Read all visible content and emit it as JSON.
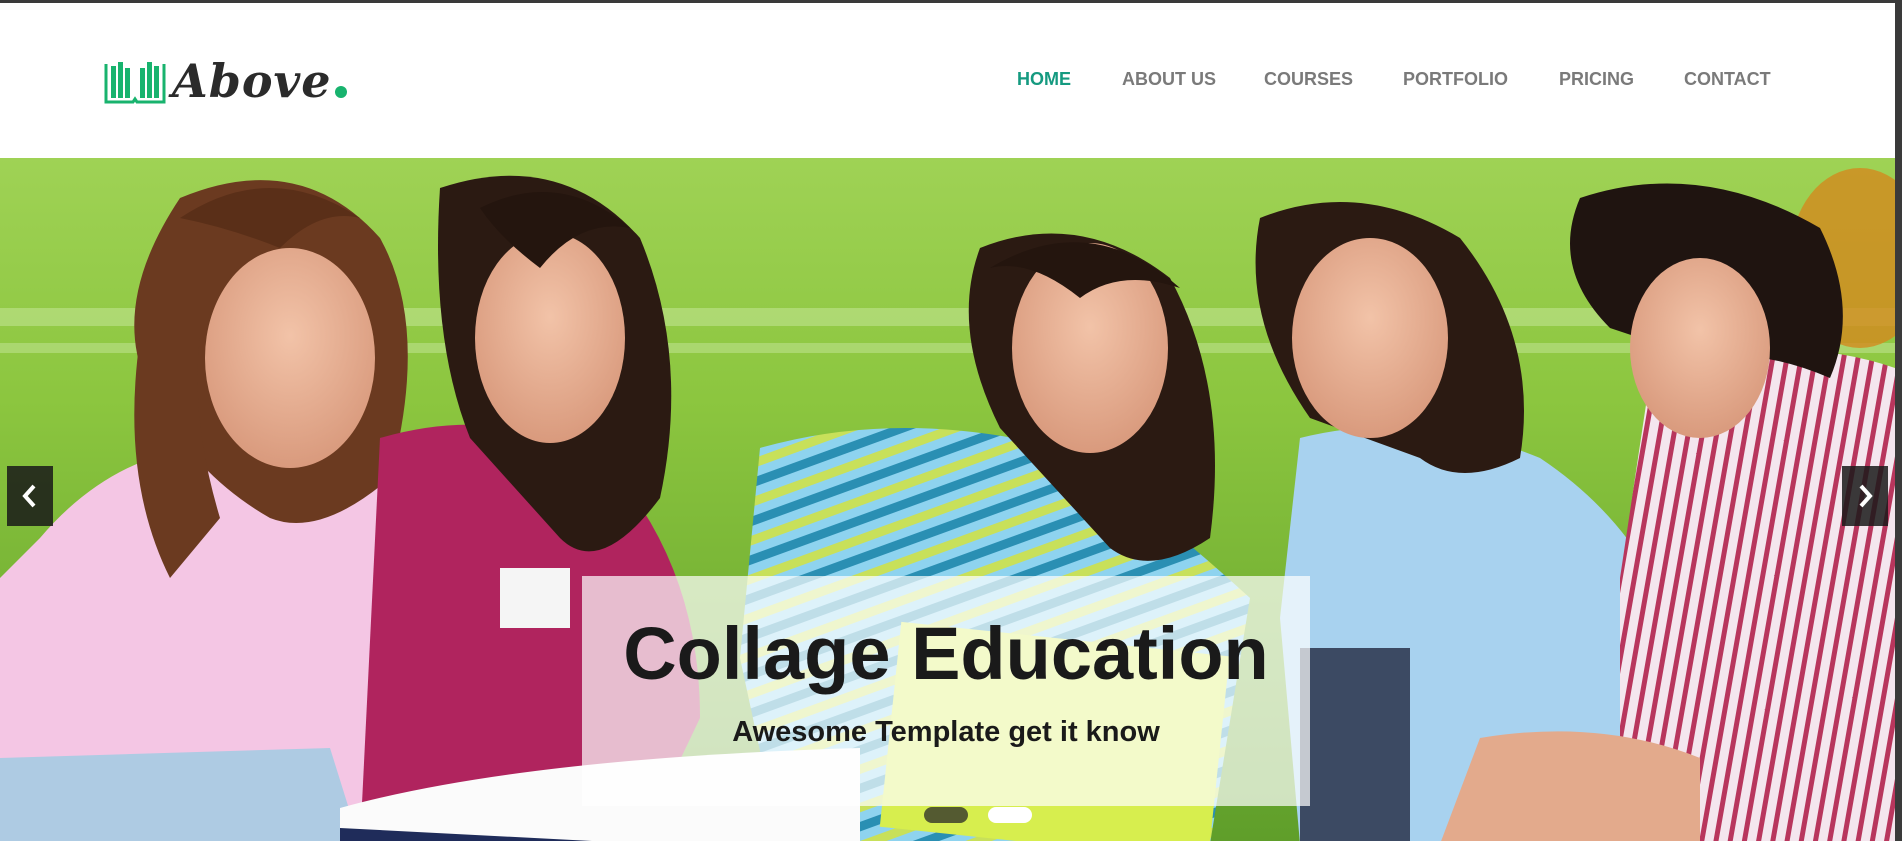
{
  "brand": {
    "name": "Above",
    "accent_color": "#18b36e"
  },
  "nav": {
    "active_color": "#159a80",
    "items": [
      {
        "label": "HOME",
        "active": true
      },
      {
        "label": "ABOUT US",
        "active": false
      },
      {
        "label": "COURSES",
        "active": false
      },
      {
        "label": "PORTFOLIO",
        "active": false
      },
      {
        "label": "PRICING",
        "active": false
      },
      {
        "label": "CONTACT",
        "active": false
      }
    ]
  },
  "hero": {
    "title": "Collage Education",
    "subtitle": "Awesome Template get it know",
    "prev_icon": "chevron-left-icon",
    "next_icon": "chevron-right-icon",
    "slides_total": 2,
    "active_slide": 2
  }
}
